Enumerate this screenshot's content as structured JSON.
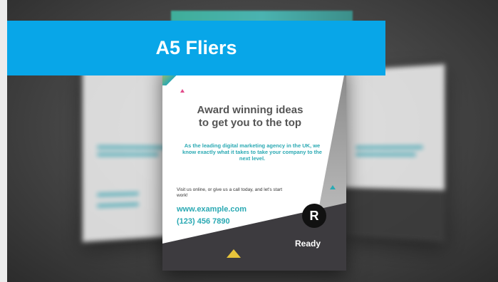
{
  "banner": {
    "title": "A5 Fliers"
  },
  "flier": {
    "headline_line1": "Award winning ideas",
    "headline_line2": "to get you to the top",
    "tagline": "As the leading digital marketing agency in the UK, we know exactly what it takes to take your company to the next level.",
    "visit_text": "Visit us online, or give us a call today, and let's start work!",
    "website": "www.example.com",
    "phone": "(123) 456 7890",
    "logo_letter": "R",
    "brand_name": "Ready"
  },
  "colors": {
    "banner": "#08a6e8",
    "accent": "#2aa9b3",
    "dark": "#3d3b3f"
  }
}
